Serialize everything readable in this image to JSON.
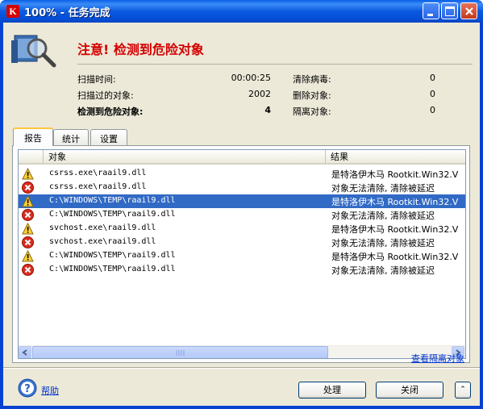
{
  "window": {
    "title": "100% - 任务完成",
    "app_icon_glyph": "K"
  },
  "header": {
    "alert_title": "注意! 检测到危险对象",
    "stats": {
      "scan_time_label": "扫描时间:",
      "scan_time_value": "00:00:25",
      "scanned_label": "扫描过的对象:",
      "scanned_value": "2002",
      "detected_label": "检测到危险对象:",
      "detected_value": "4",
      "cleaned_label": "清除病毒:",
      "cleaned_value": "0",
      "deleted_label": "删除对象:",
      "deleted_value": "0",
      "quarantined_label": "隔离对象:",
      "quarantined_value": "0"
    }
  },
  "tabs": [
    {
      "label": "报告"
    },
    {
      "label": "统计"
    },
    {
      "label": "设置"
    }
  ],
  "table": {
    "col_object": "对象",
    "col_result": "结果",
    "rows": [
      {
        "icon": "warning-icon",
        "object": "csrss.exe\\raail9.dll",
        "result": "是特洛伊木马 Rootkit.Win32.V",
        "selected": false
      },
      {
        "icon": "error-icon",
        "object": "csrss.exe\\raail9.dll",
        "result": "对象无法清除, 清除被延迟",
        "selected": false
      },
      {
        "icon": "warning-icon",
        "object": "C:\\WINDOWS\\TEMP\\raail9.dll",
        "result": "是特洛伊木马 Rootkit.Win32.V",
        "selected": true
      },
      {
        "icon": "error-icon",
        "object": "C:\\WINDOWS\\TEMP\\raail9.dll",
        "result": "对象无法清除, 清除被延迟",
        "selected": false
      },
      {
        "icon": "warning-icon",
        "object": "svchost.exe\\raail9.dll",
        "result": "是特洛伊木马 Rootkit.Win32.V",
        "selected": false
      },
      {
        "icon": "error-icon",
        "object": "svchost.exe\\raail9.dll",
        "result": "对象无法清除, 清除被延迟",
        "selected": false
      },
      {
        "icon": "warning-icon",
        "object": "C:\\WINDOWS\\TEMP\\raail9.dll",
        "result": "是特洛伊木马 Rootkit.Win32.V",
        "selected": false
      },
      {
        "icon": "error-icon",
        "object": "C:\\WINDOWS\\TEMP\\raail9.dll",
        "result": "对象无法清除, 清除被延迟",
        "selected": false
      }
    ]
  },
  "links": {
    "view_quarantine": "查看隔离对象",
    "help": "帮助"
  },
  "buttons": {
    "process": "处理",
    "close": "关闭",
    "expand": "⌃"
  },
  "colors": {
    "alert_red": "#d40000",
    "selection_blue": "#316ac5",
    "titlebar_blue": "#0a5ae0"
  }
}
